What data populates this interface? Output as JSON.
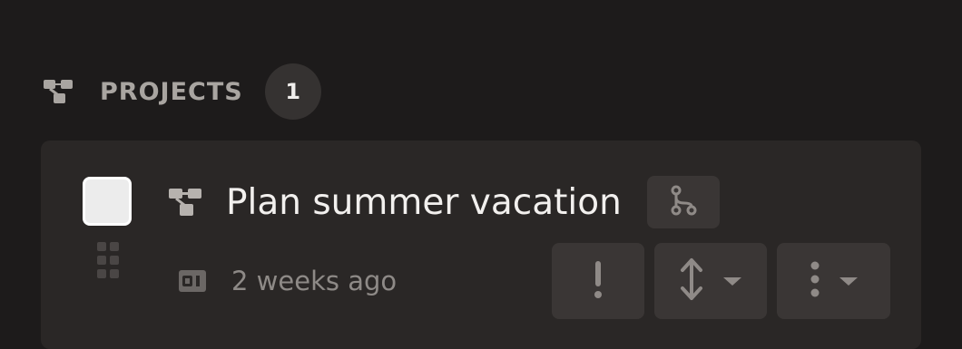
{
  "section": {
    "icon": "project-diagram-icon",
    "title": "PROJECTS",
    "count": "1"
  },
  "task": {
    "title": "Plan summer vacation",
    "title_icon": "project-diagram-icon",
    "branch_icon": "branch-icon",
    "meta_icon": "calendar-icon",
    "meta_text": "2 weeks ago",
    "checked": false
  },
  "actions": {
    "priority_icon": "exclamation-icon",
    "sort_icon": "arrows-vertical-icon",
    "more_icon": "vertical-ellipsis-icon"
  },
  "colors": {
    "background": "#1d1b1b",
    "card": "#2a2726",
    "button": "#3a3635",
    "icon_muted": "#8f8a87"
  }
}
